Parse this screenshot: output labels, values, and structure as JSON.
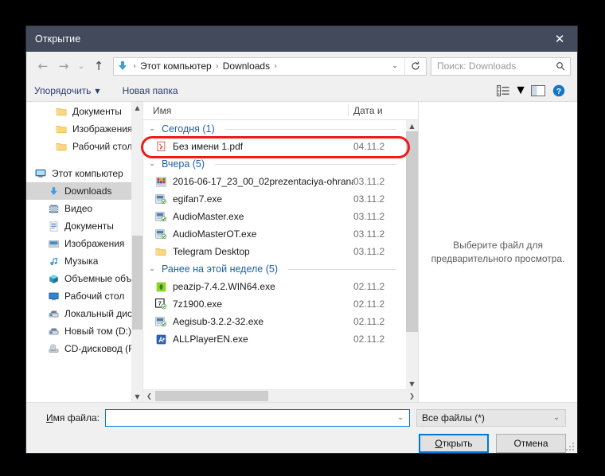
{
  "window": {
    "title": "Открытие",
    "close_label": "✕"
  },
  "nav": {
    "back_icon": "arrow-left-icon",
    "forward_icon": "arrow-right-icon",
    "recent_icon": "chevron-down-icon",
    "up_icon": "arrow-up-icon",
    "address": {
      "folder_icon": "downloads-arrow-icon",
      "crumbs": [
        "Этот компьютер",
        "Downloads"
      ],
      "separator": "›",
      "dropdown_icon": "chevron-down-icon",
      "refresh_icon": "refresh-icon"
    },
    "search": {
      "placeholder": "Поиск: Downloads",
      "icon": "search-icon"
    }
  },
  "toolbar": {
    "organize_label": "Упорядочить",
    "organize_caret": "▼",
    "new_folder_label": "Новая папка",
    "view_icon": "list-view-icon",
    "view_caret": "▼",
    "pane_icon": "preview-pane-icon",
    "help_icon": "help-icon",
    "help_glyph": "?"
  },
  "sidebar": {
    "items": [
      {
        "label": "Документы",
        "icon": "folder-yellow-icon",
        "indent": 2,
        "selected": false
      },
      {
        "label": "Изображения",
        "icon": "folder-yellow-icon",
        "indent": 2,
        "selected": false
      },
      {
        "label": "Рабочий стол",
        "icon": "folder-yellow-icon",
        "indent": 2,
        "selected": false
      },
      {
        "label": "",
        "icon": "spacer",
        "indent": 0,
        "selected": false
      },
      {
        "label": "Этот компьютер",
        "icon": "this-pc-icon",
        "indent": 0,
        "selected": false
      },
      {
        "label": "Downloads",
        "icon": "downloads-arrow-icon",
        "indent": 1,
        "selected": true
      },
      {
        "label": "Видео",
        "icon": "videos-icon",
        "indent": 1,
        "selected": false
      },
      {
        "label": "Документы",
        "icon": "documents-icon",
        "indent": 1,
        "selected": false
      },
      {
        "label": "Изображения",
        "icon": "pictures-icon",
        "indent": 1,
        "selected": false
      },
      {
        "label": "Музыка",
        "icon": "music-note-icon",
        "indent": 1,
        "selected": false
      },
      {
        "label": "Объемные объ",
        "icon": "3d-objects-icon",
        "indent": 1,
        "selected": false
      },
      {
        "label": "Рабочий стол",
        "icon": "desktop-icon",
        "indent": 1,
        "selected": false
      },
      {
        "label": "Локальный дис",
        "icon": "hard-drive-icon",
        "indent": 1,
        "selected": false
      },
      {
        "label": "Новый том (D:)",
        "icon": "hard-drive-icon",
        "indent": 1,
        "selected": false
      },
      {
        "label": "CD-дисковод (F",
        "icon": "cd-drive-icon",
        "indent": 1,
        "selected": false
      }
    ],
    "scroll": {
      "up_arrow": "▲",
      "down_arrow": "▼"
    }
  },
  "filelist": {
    "columns": {
      "name": "Имя",
      "date": "Дата и"
    },
    "groups": [
      {
        "label": "Сегодня (1)",
        "chevron": "⌄",
        "files": [
          {
            "name": "Без имени 1.pdf",
            "date": "04.11.2",
            "icon": "pdf-icon",
            "highlighted": true
          }
        ]
      },
      {
        "label": "Вчера (5)",
        "chevron": "⌄",
        "files": [
          {
            "name": "2016-06-17_23_00_02prezentaciya-ohrana...",
            "date": "03.11.2",
            "icon": "image-icon",
            "highlighted": false
          },
          {
            "name": "egifan7.exe",
            "date": "03.11.2",
            "icon": "installer-icon",
            "highlighted": false
          },
          {
            "name": "AudioMaster.exe",
            "date": "03.11.2",
            "icon": "installer-icon",
            "highlighted": false
          },
          {
            "name": "AudioMasterOT.exe",
            "date": "03.11.2",
            "icon": "installer-icon",
            "highlighted": false
          },
          {
            "name": "Telegram Desktop",
            "date": "03.11.2",
            "icon": "folder-yellow-icon",
            "highlighted": false
          }
        ]
      },
      {
        "label": "Ранее на этой неделе (5)",
        "chevron": "⌄",
        "files": [
          {
            "name": "peazip-7.4.2.WIN64.exe",
            "date": "02.11.2",
            "icon": "peazip-icon",
            "highlighted": false
          },
          {
            "name": "7z1900.exe",
            "date": "02.11.2",
            "icon": "sevenzip-icon",
            "highlighted": false
          },
          {
            "name": "Aegisub-3.2.2-32.exe",
            "date": "02.11.2",
            "icon": "installer-icon",
            "highlighted": false
          },
          {
            "name": "ALLPlayerEN.exe",
            "date": "02.11.2",
            "icon": "allplayer-icon",
            "highlighted": false
          }
        ]
      }
    ],
    "hscroll": {
      "left_arrow": "❮",
      "right_arrow": "❯"
    },
    "vscroll": {
      "up_arrow": "▲",
      "down_arrow": "▼"
    }
  },
  "preview": {
    "message_line1": "Выберите файл для",
    "message_line2": "предварительного просмотра."
  },
  "footer": {
    "filename_label_pre": "И",
    "filename_label_post": "мя файла:",
    "filename_value": "",
    "filename_chevron": "⌄",
    "filter_value": "Все файлы (*)",
    "filter_chevron": "⌄",
    "open_pre": "О",
    "open_post": "ткрыть",
    "cancel_label": "Отмена"
  },
  "annotation": {
    "color": "#ee1b1b",
    "target": "Без имени 1.pdf"
  }
}
